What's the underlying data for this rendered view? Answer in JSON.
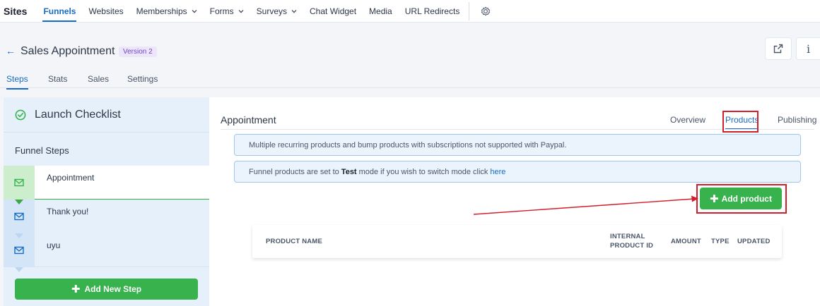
{
  "topnav": {
    "brand": "Sites",
    "items": [
      {
        "label": "Funnels",
        "dropdown": false,
        "active": true
      },
      {
        "label": "Websites",
        "dropdown": false
      },
      {
        "label": "Memberships",
        "dropdown": true
      },
      {
        "label": "Forms",
        "dropdown": true
      },
      {
        "label": "Surveys",
        "dropdown": true
      },
      {
        "label": "Chat Widget",
        "dropdown": false
      },
      {
        "label": "Media",
        "dropdown": false
      },
      {
        "label": "URL Redirects",
        "dropdown": false
      }
    ],
    "chevron": "⌄"
  },
  "header": {
    "back_arrow": "←",
    "title": "Sales Appointment",
    "version": "Version 2",
    "info_icon": "i"
  },
  "subtabs": {
    "steps": "Steps",
    "stats": "Stats",
    "sales": "Sales",
    "settings": "Settings"
  },
  "sidebar": {
    "checklist_label": "Launch Checklist",
    "funnel_steps_heading": "Funnel Steps",
    "steps": [
      {
        "label": "Appointment",
        "active": true
      },
      {
        "label": "Thank you!",
        "active": false
      },
      {
        "label": "uyu",
        "active": false
      }
    ],
    "add_step_label": "Add New Step"
  },
  "main": {
    "title": "Appointment",
    "tabs": {
      "overview": "Overview",
      "products": "Products",
      "publishing": "Publishing"
    },
    "notice_paypal": "Multiple recurring products and bump products with subscriptions not supported with Paypal.",
    "notice_mode_pre": "Funnel products are set to",
    "notice_mode_bold": "Test",
    "notice_mode_post": "mode if you wish to switch mode click",
    "notice_mode_link": "here",
    "add_product_label": "Add product",
    "table_headers": {
      "product_name": "PRODUCT NAME",
      "internal_id_line1": "INTERNAL",
      "internal_id_line2": "PRODUCT ID",
      "amount": "AMOUNT",
      "type": "TYPE",
      "updated": "UPDATED"
    }
  },
  "colors": {
    "accent": "#1a6bc4",
    "success": "#37b24d",
    "annotation": "#d21f2b"
  }
}
